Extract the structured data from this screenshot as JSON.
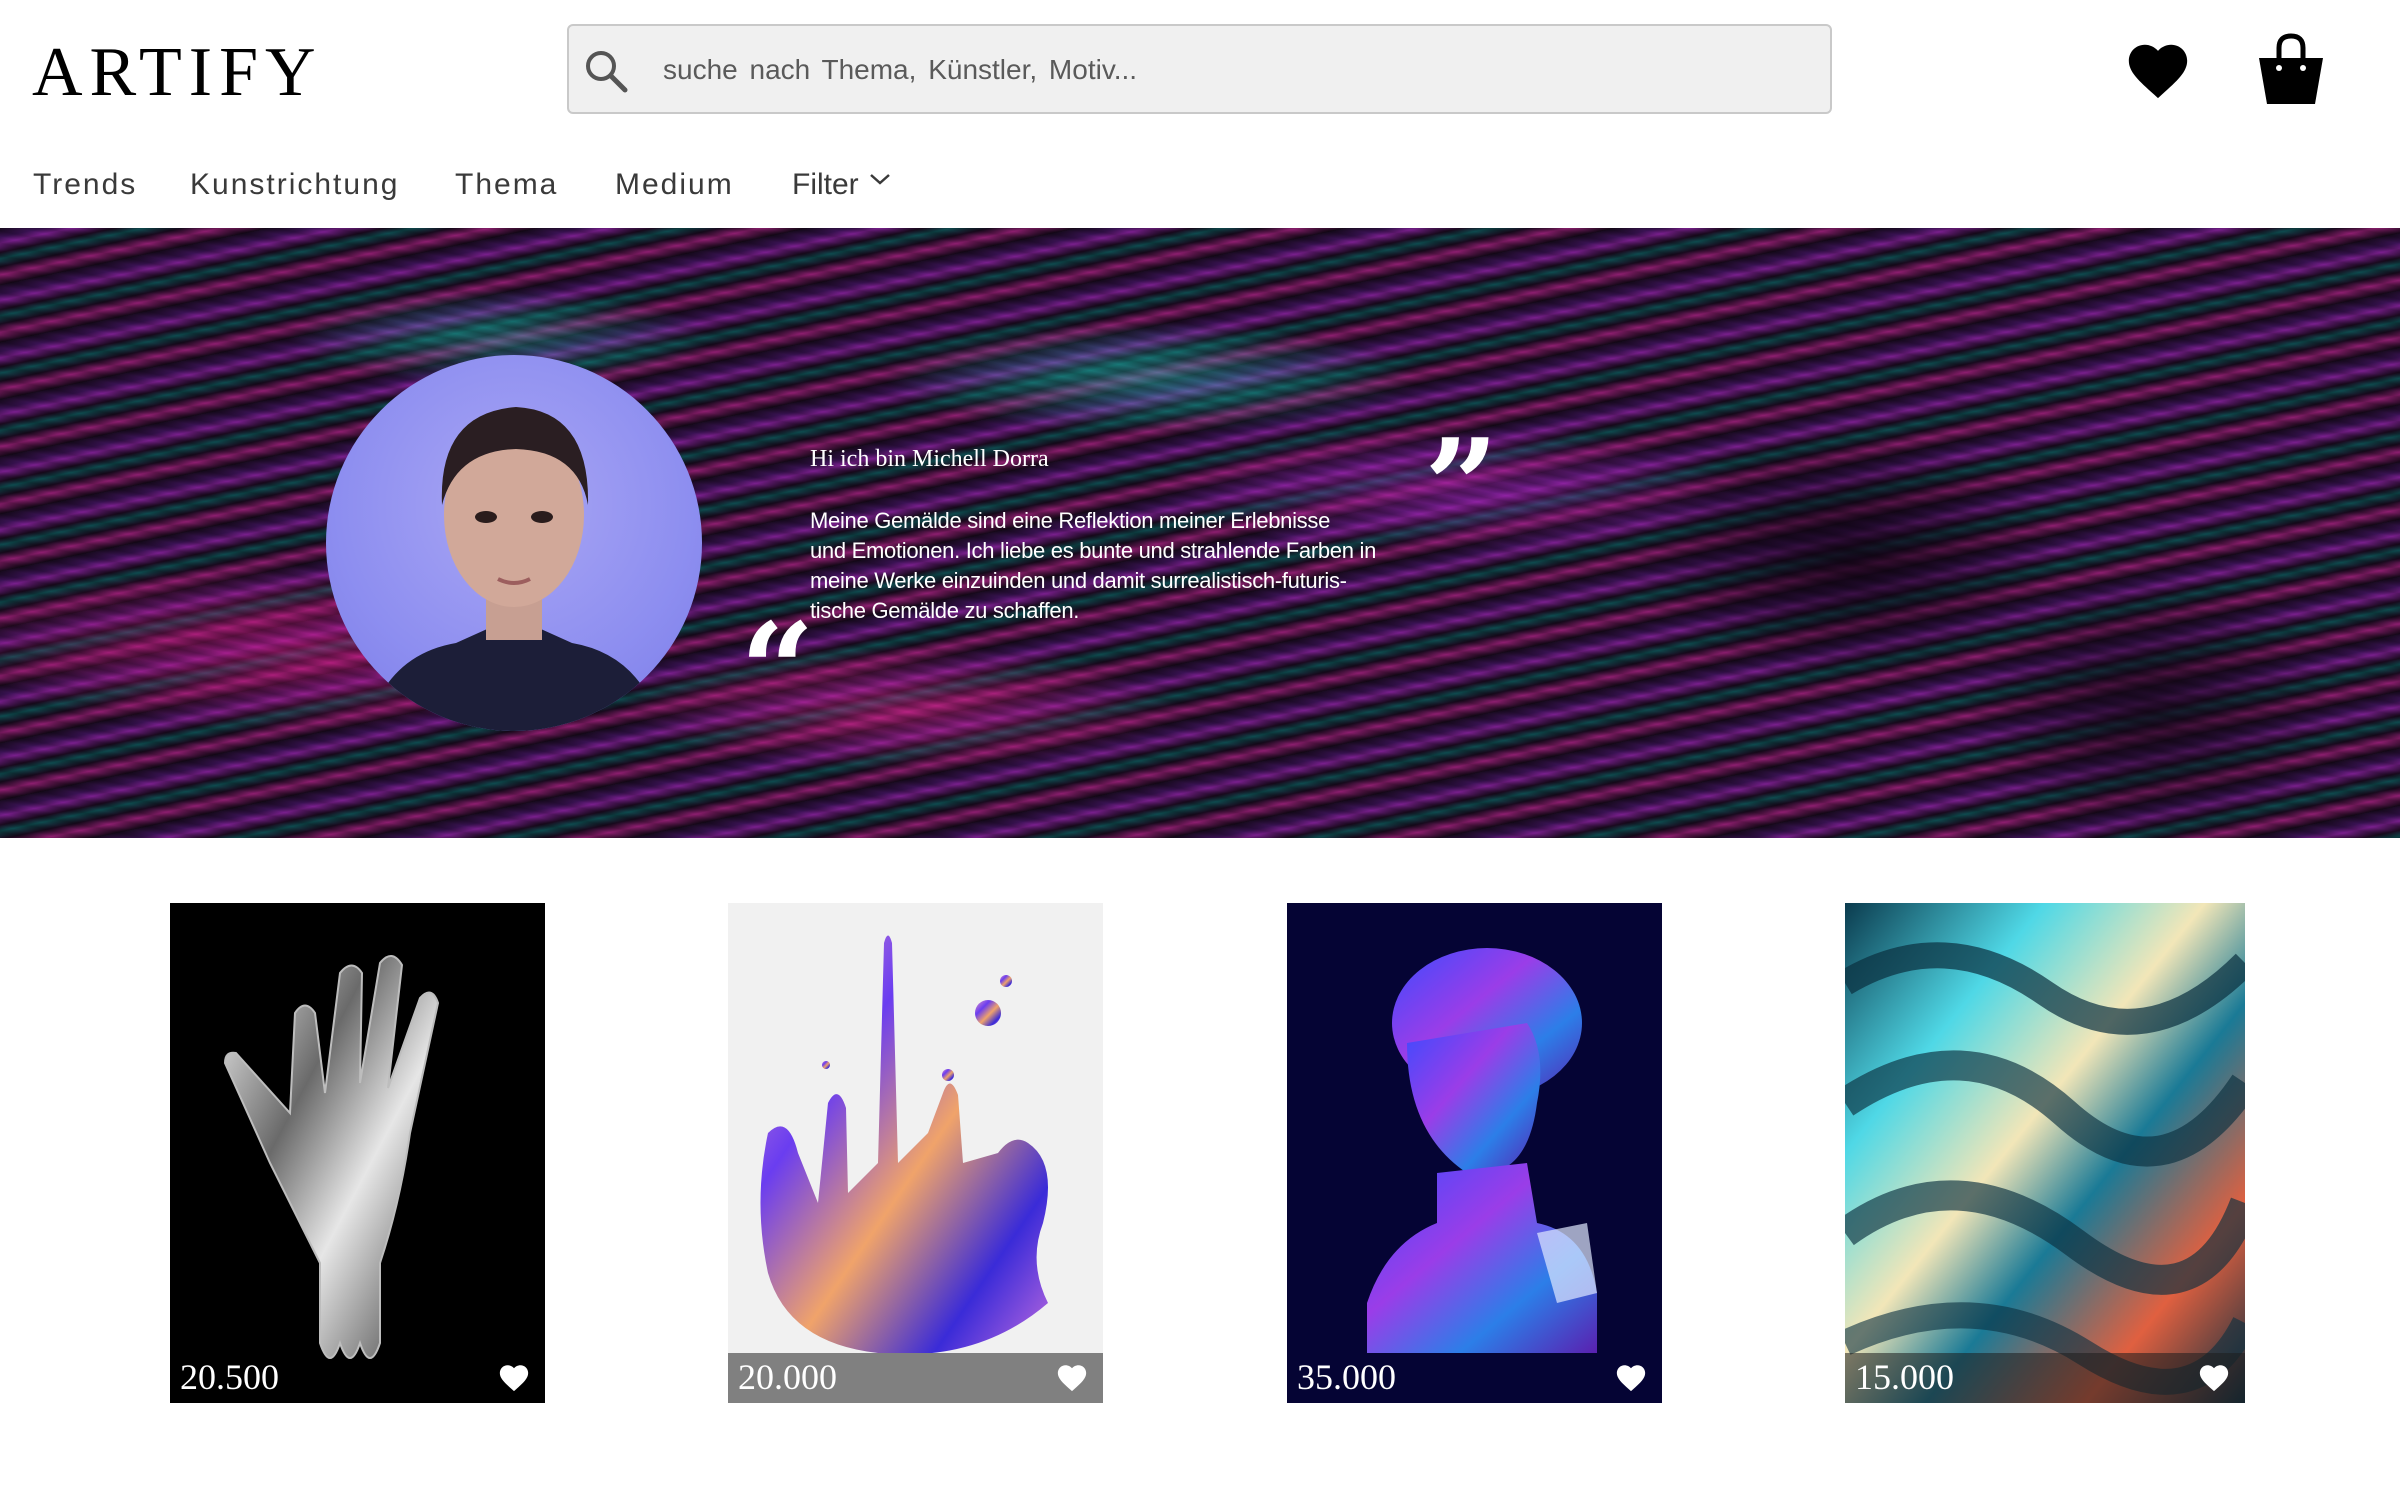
{
  "header": {
    "logo": "ARTIFY",
    "search_placeholder": "suche nach Thema, Künstler, Motiv...",
    "favorites_icon": "heart-icon",
    "cart_icon": "shopping-bag-icon"
  },
  "nav": {
    "items": [
      "Trends",
      "Kunstrichtung",
      "Thema",
      "Medium"
    ],
    "filter_label": "Filter"
  },
  "hero": {
    "greeting": "Hi ich bin Michell Dorra",
    "bio_lines": [
      "Meine Gemälde sind eine Reflektion meiner Erlebnisse",
      "und Emotionen. Ich liebe es bunte und strahlende Farben in",
      "meine Werke einzuinden und damit surrealistisch-futuris-",
      "tische Gemälde zu schaffen."
    ],
    "quote_open": "“",
    "quote_close": "”"
  },
  "artworks": [
    {
      "price": "20.500",
      "icon": "heart-icon"
    },
    {
      "price": "20.000",
      "icon": "heart-icon"
    },
    {
      "price": "35.000",
      "icon": "heart-icon"
    },
    {
      "price": "15.000",
      "icon": "heart-icon"
    }
  ],
  "colors": {
    "accent_magenta": "#e01e8c",
    "accent_teal": "#2bc4b8",
    "accent_purple": "#7a1f8e"
  }
}
